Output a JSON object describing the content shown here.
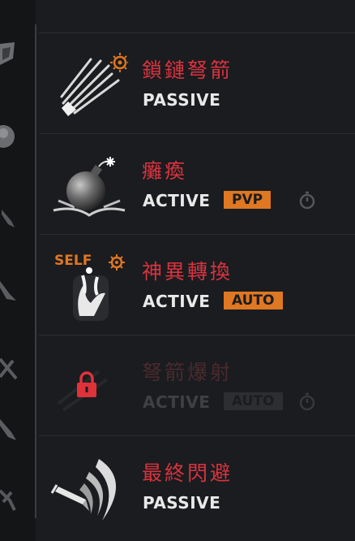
{
  "skills": [
    {
      "name": "鎖鏈弩箭",
      "type": "PASSIVE",
      "icon": "chain-crossbow-bolt-icon"
    },
    {
      "name": "癱瘓",
      "type": "ACTIVE",
      "tag": "PVP",
      "icon": "bomb-icon",
      "has_timer": true
    },
    {
      "name": "神異轉換",
      "type": "ACTIVE",
      "tag": "AUTO",
      "icon": "hand-swap-icon",
      "self_label": "SELF"
    },
    {
      "name": "弩箭爆射",
      "type": "ACTIVE",
      "tag": "AUTO",
      "icon": "lock-icon",
      "locked": true,
      "has_timer": true
    },
    {
      "name": "最終閃避",
      "type": "PASSIVE",
      "icon": "dodge-swirl-icon"
    }
  ],
  "colors": {
    "skill_name": "#d8333f",
    "tag_bg": "#e07722",
    "type_text": "#e9e9e9",
    "background": "#1a1c1f"
  }
}
